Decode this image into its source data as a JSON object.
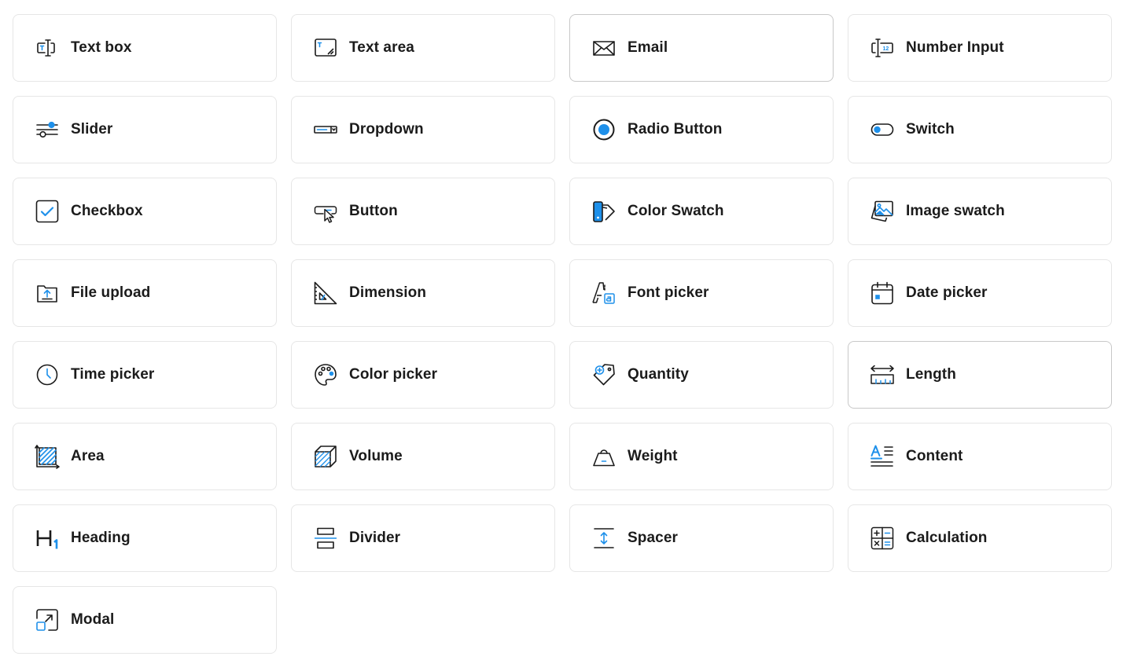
{
  "accent_color": "#1e90ea",
  "items": [
    {
      "label": "Text box",
      "icon": "text-box-icon"
    },
    {
      "label": "Text area",
      "icon": "text-area-icon"
    },
    {
      "label": "Email",
      "icon": "email-icon"
    },
    {
      "label": "Number Input",
      "icon": "number-input-icon"
    },
    {
      "label": "Slider",
      "icon": "slider-icon"
    },
    {
      "label": "Dropdown",
      "icon": "dropdown-icon"
    },
    {
      "label": "Radio Button",
      "icon": "radio-button-icon"
    },
    {
      "label": "Switch",
      "icon": "switch-icon"
    },
    {
      "label": "Checkbox",
      "icon": "checkbox-icon"
    },
    {
      "label": "Button",
      "icon": "button-icon"
    },
    {
      "label": "Color Swatch",
      "icon": "color-swatch-icon"
    },
    {
      "label": "Image swatch",
      "icon": "image-swatch-icon"
    },
    {
      "label": "File upload",
      "icon": "file-upload-icon"
    },
    {
      "label": "Dimension",
      "icon": "dimension-icon"
    },
    {
      "label": "Font picker",
      "icon": "font-picker-icon"
    },
    {
      "label": "Date picker",
      "icon": "date-picker-icon"
    },
    {
      "label": "Time picker",
      "icon": "time-picker-icon"
    },
    {
      "label": "Color picker",
      "icon": "color-picker-icon"
    },
    {
      "label": "Quantity",
      "icon": "quantity-icon"
    },
    {
      "label": "Length",
      "icon": "length-icon"
    },
    {
      "label": "Area",
      "icon": "area-icon"
    },
    {
      "label": "Volume",
      "icon": "volume-icon"
    },
    {
      "label": "Weight",
      "icon": "weight-icon"
    },
    {
      "label": "Content",
      "icon": "content-icon"
    },
    {
      "label": "Heading",
      "icon": "heading-icon"
    },
    {
      "label": "Divider",
      "icon": "divider-icon"
    },
    {
      "label": "Spacer",
      "icon": "spacer-icon"
    },
    {
      "label": "Calculation",
      "icon": "calculation-icon"
    },
    {
      "label": "Modal",
      "icon": "modal-icon"
    }
  ]
}
